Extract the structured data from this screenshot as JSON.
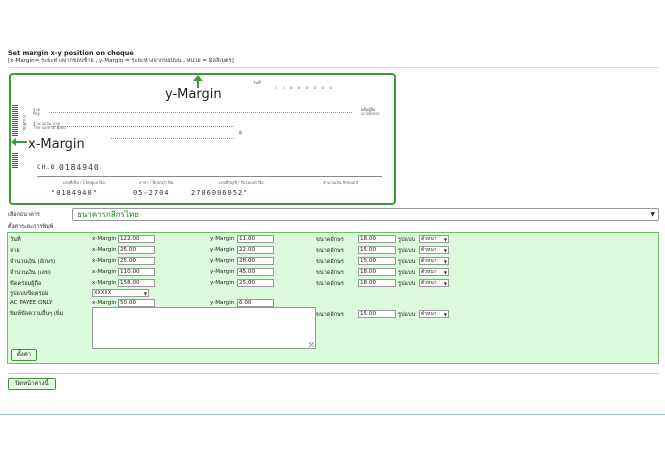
{
  "page": {
    "title": "Set margin x-y position on cheque",
    "subtitle": "[x-Margin= ระยะห่างจากขอบซ้าย , y-Margin = ระยะห่างจากขอบบน , หน่วย = มิลลิเมตร]"
  },
  "cheque_preview": {
    "y_margin_label": "y-Margin",
    "x_margin_label": "x-Margin",
    "date_label": "วันที่",
    "pay_label": "จ่าย",
    "pay_en": "Pay",
    "or_bearer": "หรือผู้ถือ",
    "or_bearer_en": "or bearer",
    "amount_label": "จำนวนเงิน บาท",
    "amount_en": "The sum of Baht",
    "baht_symbol": "฿",
    "cheque_no_label": "CH.B",
    "cheque_no": "0184940",
    "micr_line_1": "\"0184940\"",
    "micr_line_2": "05-2704",
    "micr_line_3": "2706006052\"",
    "field_cheque_no": "เลขที่เช็ค / Cheque No.",
    "field_branch": "สาขา / Branch No.",
    "field_account": "เลขที่บัญชี / Account No.",
    "field_amount": "จำนวนเงิน Amount",
    "side_label": "ด่วนที่สุด"
  },
  "bank": {
    "label": "เลือกธนาคาร",
    "selected": "ธนาคารกสิกรไทย"
  },
  "settings_label": "ตั้งค่าระยะการพิมพ์",
  "rows": [
    {
      "label": "วันที่",
      "x_label": "x-Margin",
      "x": "122.00",
      "y_label": "y-Margin",
      "y": "11.00",
      "size_label": "ขนาดอักษร",
      "size": "18.00",
      "format_label": "รูปแบบ",
      "format": "ตัวหนา"
    },
    {
      "label": "จ่าย",
      "x_label": "x-Margin",
      "x": "25.00",
      "y_label": "y-Margin",
      "y": "22.00",
      "size_label": "ขนาดอักษร",
      "size": "15.00",
      "format_label": "รูปแบบ",
      "format": "ตัวหนา"
    },
    {
      "label": "จำนวนเงิน (อักษร)",
      "x_label": "x-Margin",
      "x": "25.00",
      "y_label": "y-Margin",
      "y": "28.00",
      "size_label": "ขนาดอักษร",
      "size": "15.00",
      "format_label": "รูปแบบ",
      "format": "ตัวหนา"
    },
    {
      "label": "จำนวนเงิน (เลข)",
      "x_label": "x-Margin",
      "x": "110.00",
      "y_label": "y-Margin",
      "y": "45.00",
      "size_label": "ขนาดอักษร",
      "size": "18.00",
      "format_label": "รูปแบบ",
      "format": "ตัวหนา"
    },
    {
      "label": "ขีดคร่อมผู้ถือ",
      "x_label": "x-Margin",
      "x": "158.00",
      "y_label": "y-Margin",
      "y": "25.00",
      "size_label": "ขนาดอักษร",
      "size": "18.00",
      "format_label": "รูปแบบ",
      "format": "ตัวหนา"
    }
  ],
  "crossing": {
    "label": "รูปแบบขีดคร่อม",
    "selected": "XXXXX"
  },
  "ac_payee": {
    "label": "AC PAYEE ONLY",
    "x_label": "x-Margin",
    "x": "50.00",
    "y_label": "y-Margin",
    "y": "6.00"
  },
  "note": {
    "label": "พิมพ์ข้อความอื่นๆ เพิ่ม",
    "size_label": "ขนาดอักษร",
    "size": "15.00",
    "format_label": "รูปแบบ",
    "format": "ตัวหนา"
  },
  "buttons": {
    "save": "ตั้งค่า",
    "close": "ปิดหน้าต่างนี้"
  },
  "colors": {
    "accent_green": "#3c9a3c",
    "panel_bg": "#dcfadc",
    "bank_text": "#2a7d2a"
  }
}
